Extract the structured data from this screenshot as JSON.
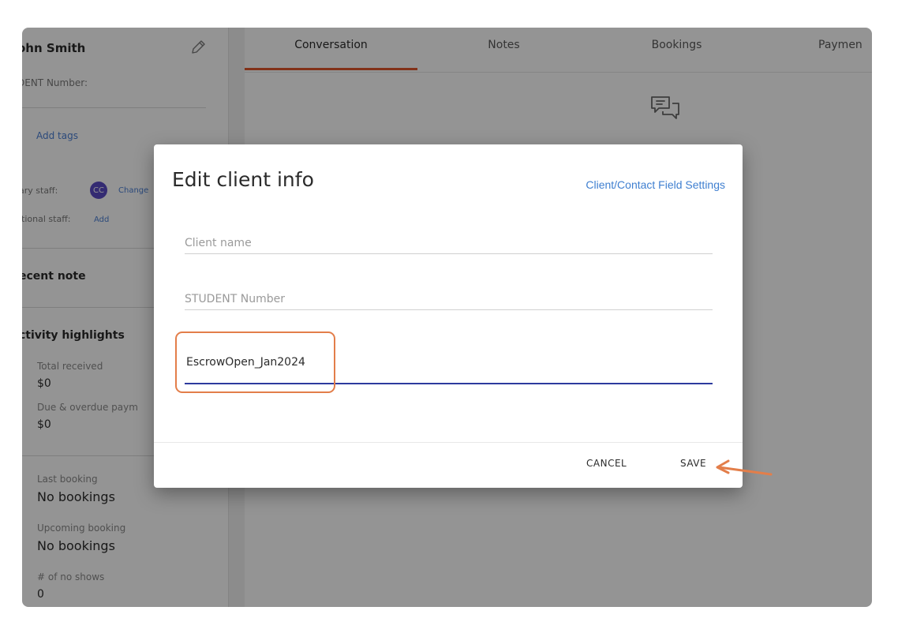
{
  "sidebar": {
    "client_name": "ohn Smith",
    "student_number_label": "DENT Number:",
    "tags_prefix": ":",
    "tags_link": "Add tags",
    "primary_staff_label": "ary staff:",
    "primary_staff_avatar": "CC",
    "primary_staff_change": "Change",
    "additional_staff_label": "itional staff:",
    "additional_staff_add": "Add",
    "recent_note_heading": "ecent note",
    "activity_heading": "ctivity highlights",
    "total_received_label": "Total received",
    "total_received_value": "$0",
    "due_label": "Due & overdue paym",
    "due_value": "$0",
    "last_booking_label": "Last booking",
    "last_booking_value": "No bookings",
    "upcoming_booking_label": "Upcoming booking",
    "upcoming_booking_value": "No bookings",
    "no_shows_label": "# of no shows",
    "no_shows_value": "0"
  },
  "tabs": [
    {
      "label": "Conversation",
      "active": true
    },
    {
      "label": "Notes",
      "active": false
    },
    {
      "label": "Bookings",
      "active": false
    },
    {
      "label": "Paymen",
      "active": false
    }
  ],
  "dialog": {
    "title": "Edit client info",
    "settings_link": "Client/Contact Field Settings",
    "client_name_placeholder": "Client name",
    "student_number_placeholder": "STUDENT Number",
    "custom_field_value": "EscrowOpen_Jan2024",
    "cancel_label": "CANCEL",
    "save_label": "SAVE"
  },
  "colors": {
    "accent_tab": "#e0562b",
    "link": "#3f7fd0",
    "active_field": "#2d3b9e",
    "highlight_annotation": "#e37e4a",
    "avatar": "#5b4bc4"
  },
  "icons": [
    "pencil-icon",
    "chat-bubbles-icon",
    "arrow-annotation-icon"
  ]
}
